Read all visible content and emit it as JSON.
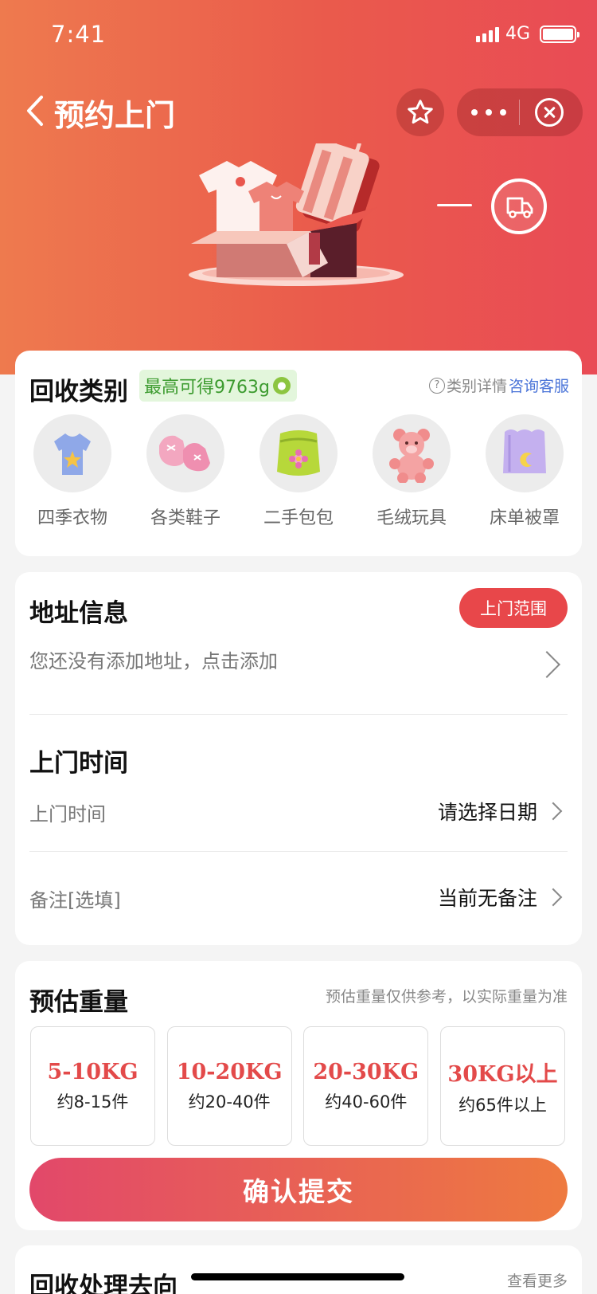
{
  "status_bar": {
    "time": "7:41",
    "network": "4G",
    "battery_level": 1.0
  },
  "nav": {
    "title": "预约上门"
  },
  "category_card": {
    "title": "回收类别",
    "badge": "最高可得9763g",
    "help_text": "类别详情",
    "help_link": "咨询客服",
    "items": [
      {
        "label": "四季衣物",
        "icon": "tshirt-icon"
      },
      {
        "label": "各类鞋子",
        "icon": "shoes-icon"
      },
      {
        "label": "二手包包",
        "icon": "bag-icon"
      },
      {
        "label": "毛绒玩具",
        "icon": "teddy-bear-icon"
      },
      {
        "label": "床单被罩",
        "icon": "bedding-icon"
      }
    ]
  },
  "address_card": {
    "title": "地址信息",
    "range_button": "上门范围",
    "address_placeholder": "您还没有添加地址，点击添加",
    "time_title": "上门时间",
    "time_row_label": "上门时间",
    "time_row_value": "请选择日期",
    "note_row_label": "备注[选填]",
    "note_row_value": "当前无备注"
  },
  "weight_card": {
    "title": "预估重量",
    "note": "预估重量仅供参考，以实际重量为准",
    "options": [
      {
        "kg": "5-10KG",
        "count": "约8-15件"
      },
      {
        "kg": "10-20KG",
        "count": "约20-40件"
      },
      {
        "kg": "20-30KG",
        "count": "约40-60件"
      },
      {
        "kg": "30KG以上",
        "count": "约65件以上"
      }
    ]
  },
  "submit_label": "确认提交",
  "destination_card": {
    "title": "回收处理去向",
    "more": "查看更多"
  },
  "colors": {
    "accent": "#e8474a",
    "gradient_start": "#e2486a",
    "gradient_end": "#ee7a40",
    "link": "#4a74d8",
    "badge_text": "#3c9b2f"
  }
}
